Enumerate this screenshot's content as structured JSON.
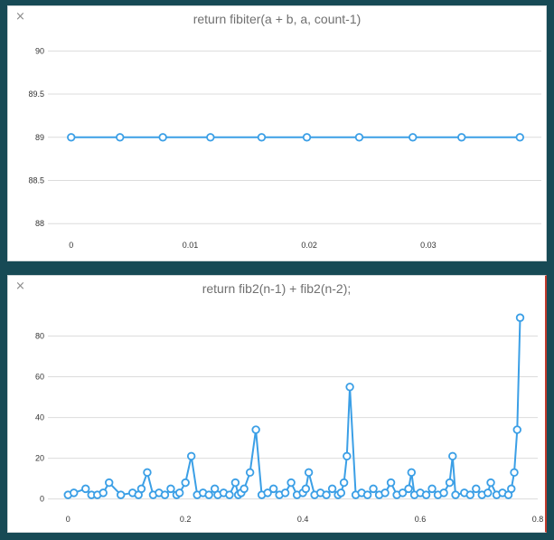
{
  "panels": [
    {
      "close_label": "×",
      "title": "return fibiter(a + b, a, count-1)"
    },
    {
      "close_label": "×",
      "title": "return fib2(n-1) + fib2(n-2);"
    }
  ],
  "colors": {
    "series": "#3b9fe6",
    "background": "#174a55",
    "grid": "#dcdcdc"
  },
  "chart_data": [
    {
      "type": "line",
      "title": "return fibiter(a + b, a, count-1)",
      "xlim": [
        -0.0015,
        0.0395
      ],
      "ylim": [
        87.95,
        90.15
      ],
      "x_ticks": [
        0,
        0.01,
        0.02,
        0.03
      ],
      "x_tick_labels": [
        "0",
        "0.01",
        "0.02",
        "0.03"
      ],
      "y_ticks": [
        88,
        88.5,
        89,
        89.5,
        90
      ],
      "y_tick_labels": [
        "88",
        "88.5",
        "89",
        "89.5",
        "90"
      ],
      "grid": true,
      "series": [
        {
          "x": [
            0,
            0.0041,
            0.0077,
            0.0117,
            0.016,
            0.0198,
            0.0242,
            0.0287,
            0.0328,
            0.0377
          ],
          "y": [
            89,
            89,
            89,
            89,
            89,
            89,
            89,
            89,
            89,
            89
          ]
        }
      ]
    },
    {
      "type": "line",
      "title": "return fib2(n-1) + fib2(n-2);",
      "xlim": [
        -0.025,
        0.8
      ],
      "ylim": [
        -1.5,
        94
      ],
      "x_ticks": [
        0,
        0.2,
        0.4,
        0.6,
        0.8
      ],
      "x_tick_labels": [
        "0",
        "0.2",
        "0.4",
        "0.6",
        "0.8"
      ],
      "y_ticks": [
        0,
        20,
        40,
        60,
        80
      ],
      "y_tick_labels": [
        "0",
        "20",
        "40",
        "60",
        "80"
      ],
      "grid": true,
      "series": [
        {
          "x": [
            0,
            0.01,
            0.03,
            0.04,
            0.05,
            0.06,
            0.07,
            0.09,
            0.11,
            0.12,
            0.125,
            0.135,
            0.145,
            0.155,
            0.165,
            0.175,
            0.185,
            0.19,
            0.2,
            0.21,
            0.22,
            0.23,
            0.24,
            0.25,
            0.255,
            0.265,
            0.275,
            0.285,
            0.29,
            0.295,
            0.3,
            0.31,
            0.32,
            0.33,
            0.34,
            0.35,
            0.36,
            0.37,
            0.38,
            0.39,
            0.4,
            0.405,
            0.41,
            0.42,
            0.43,
            0.44,
            0.45,
            0.46,
            0.465,
            0.47,
            0.475,
            0.48,
            0.49,
            0.5,
            0.51,
            0.52,
            0.53,
            0.54,
            0.55,
            0.56,
            0.57,
            0.58,
            0.585,
            0.59,
            0.6,
            0.61,
            0.62,
            0.63,
            0.64,
            0.65,
            0.655,
            0.66,
            0.675,
            0.685,
            0.695,
            0.705,
            0.715,
            0.72,
            0.73,
            0.74,
            0.75,
            0.755,
            0.76,
            0.765,
            0.77
          ],
          "y": [
            2,
            3,
            5,
            2,
            2,
            3,
            8,
            2,
            3,
            2,
            5,
            13,
            2,
            3,
            2,
            5,
            2,
            3,
            8,
            21,
            2,
            3,
            2,
            5,
            2,
            3,
            2,
            8,
            2,
            3,
            5,
            13,
            34,
            2,
            3,
            5,
            2,
            3,
            8,
            2,
            3,
            5,
            13,
            2,
            3,
            2,
            5,
            2,
            3,
            8,
            21,
            55,
            2,
            3,
            2,
            5,
            2,
            3,
            8,
            2,
            3,
            5,
            13,
            2,
            3,
            2,
            5,
            2,
            3,
            8,
            21,
            2,
            3,
            2,
            5,
            2,
            3,
            8,
            2,
            3,
            2,
            5,
            13,
            34,
            89
          ]
        }
      ]
    }
  ]
}
